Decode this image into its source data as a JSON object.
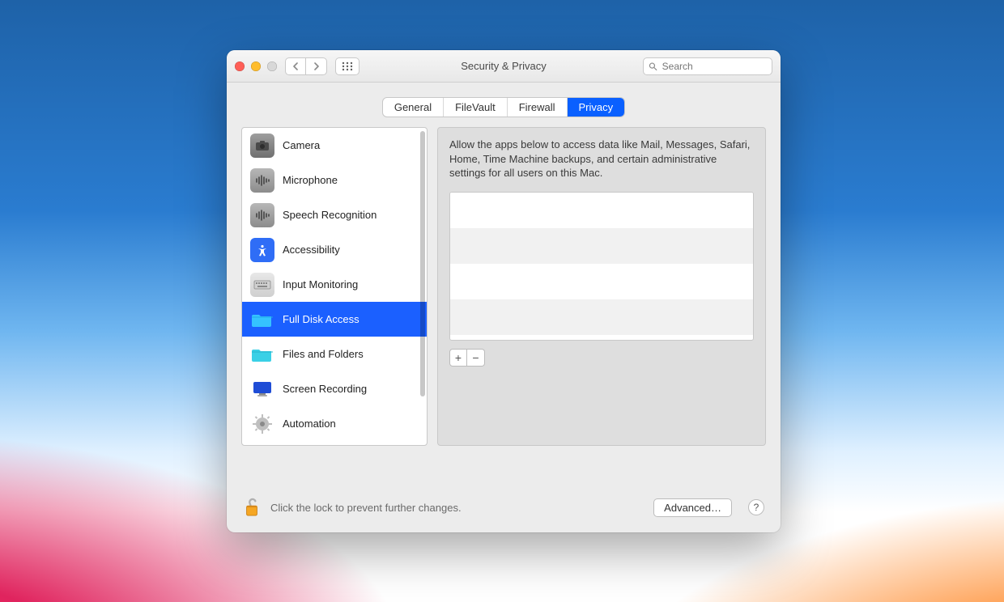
{
  "window": {
    "title": "Security & Privacy",
    "search_placeholder": "Search"
  },
  "tabs": {
    "items": [
      {
        "label": "General",
        "active": false
      },
      {
        "label": "FileVault",
        "active": false
      },
      {
        "label": "Firewall",
        "active": false
      },
      {
        "label": "Privacy",
        "active": true
      }
    ]
  },
  "sidebar": {
    "items": [
      {
        "label": "Camera",
        "icon": "camera",
        "selected": false
      },
      {
        "label": "Microphone",
        "icon": "waveform",
        "selected": false
      },
      {
        "label": "Speech Recognition",
        "icon": "waveform",
        "selected": false
      },
      {
        "label": "Accessibility",
        "icon": "accessibility",
        "selected": false
      },
      {
        "label": "Input Monitoring",
        "icon": "keyboard",
        "selected": false
      },
      {
        "label": "Full Disk Access",
        "icon": "folder-blue",
        "selected": true
      },
      {
        "label": "Files and Folders",
        "icon": "folder-cyan",
        "selected": false
      },
      {
        "label": "Screen Recording",
        "icon": "display",
        "selected": false
      },
      {
        "label": "Automation",
        "icon": "gear",
        "selected": false
      }
    ]
  },
  "detail": {
    "description": "Allow the apps below to access data like Mail, Messages, Safari, Home, Time Machine backups, and certain administrative settings for all users on this Mac."
  },
  "footer": {
    "lock_text": "Click the lock to prevent further changes.",
    "advanced_label": "Advanced…"
  },
  "glyphs": {
    "plus": "+",
    "minus": "−",
    "help": "?"
  }
}
